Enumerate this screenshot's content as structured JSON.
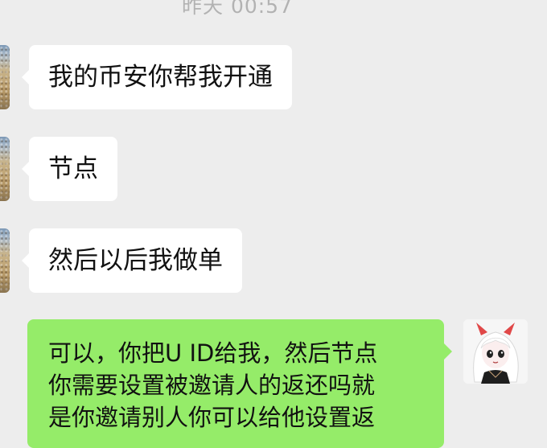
{
  "chat": {
    "timestamp": "昨天 00:57",
    "messages": [
      {
        "side": "left",
        "text": "我的币安你帮我开通"
      },
      {
        "side": "left",
        "text": "节点"
      },
      {
        "side": "left",
        "text": "然后以后我做单"
      },
      {
        "side": "right",
        "lines": [
          "可以，你把U ID给我，然后节点",
          "你需要设置被邀请人的返还吗就",
          "是你邀请别人你可以给他设置返"
        ]
      }
    ]
  },
  "colors": {
    "background": "#ededed",
    "incoming_bubble": "#ffffff",
    "outgoing_bubble": "#95ec69",
    "timestamp_text": "#b2b2b2"
  },
  "icons": {
    "left_avatar": "beach-photo-avatar",
    "right_avatar": "anime-devil-girl-avatar"
  }
}
